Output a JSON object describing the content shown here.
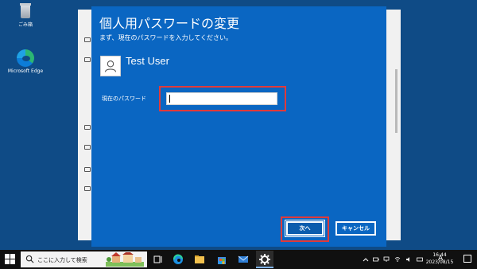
{
  "desktop": {
    "icons": [
      {
        "label": "ごみ箱",
        "icon": "recycle-bin-icon"
      },
      {
        "label": "Microsoft Edge",
        "icon": "edge-icon"
      }
    ]
  },
  "dialog": {
    "title": "個人用パスワードの変更",
    "instruction": "まず、現在のパスワードを入力してください。",
    "user_name": "Test User",
    "password_label": "現在のパスワード",
    "password_value": "",
    "next_label": "次へ",
    "cancel_label": "キャンセル"
  },
  "taskbar": {
    "search_placeholder": "ここに入力して検索",
    "ime": "A",
    "time": "16:44",
    "date": "2023/08/15"
  },
  "colors": {
    "desktop": "#0f4b86",
    "dialog": "#0a66c2",
    "highlight": "#e03a3a"
  }
}
